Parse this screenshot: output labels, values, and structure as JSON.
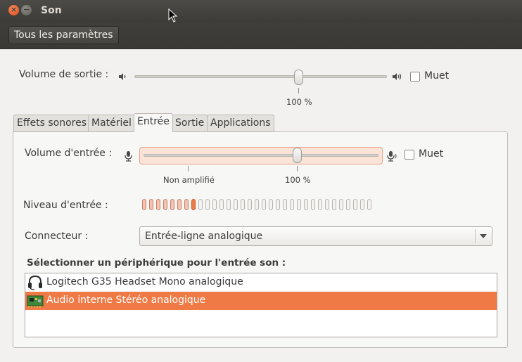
{
  "window": {
    "title": "Son",
    "close_glyph": "×",
    "minimize_glyph": "−"
  },
  "toolbar": {
    "all_settings_label": "Tous les paramètres"
  },
  "output": {
    "volume_label": "Volume de sortie :",
    "volume_level": 1.0,
    "volume_percent_label": "100 %",
    "mute_label": "Muet",
    "muted": false
  },
  "tabs": [
    {
      "label": "Effets sonores",
      "active": false
    },
    {
      "label": "Matériel",
      "active": false
    },
    {
      "label": "Entrée",
      "active": true
    },
    {
      "label": "Sortie",
      "active": false
    },
    {
      "label": "Applications",
      "active": false
    }
  ],
  "input": {
    "volume_label": "Volume d'entrée :",
    "volume_level": 1.0,
    "unamplified_label": "Non amplifié",
    "volume_percent_label": "100 %",
    "mute_label": "Muet",
    "muted": false,
    "level_label": "Niveau d'entrée :",
    "level_segments_total": 33,
    "level_segments_lit": 8,
    "connector_label": "Connecteur :",
    "connector_value": "Entrée-ligne analogique",
    "device_section_title": "Sélectionner un périphérique pour l'entrée son :",
    "devices": [
      {
        "name": "Logitech G35 Headset Mono analogique",
        "icon": "headset-icon",
        "selected": false
      },
      {
        "name": "Audio interne Stéréo analogique",
        "icon": "sound-card-icon",
        "selected": true
      }
    ]
  },
  "colors": {
    "accent": "#ef7a45",
    "titlebar": "#3c3b37",
    "background": "#f2f1f0"
  }
}
